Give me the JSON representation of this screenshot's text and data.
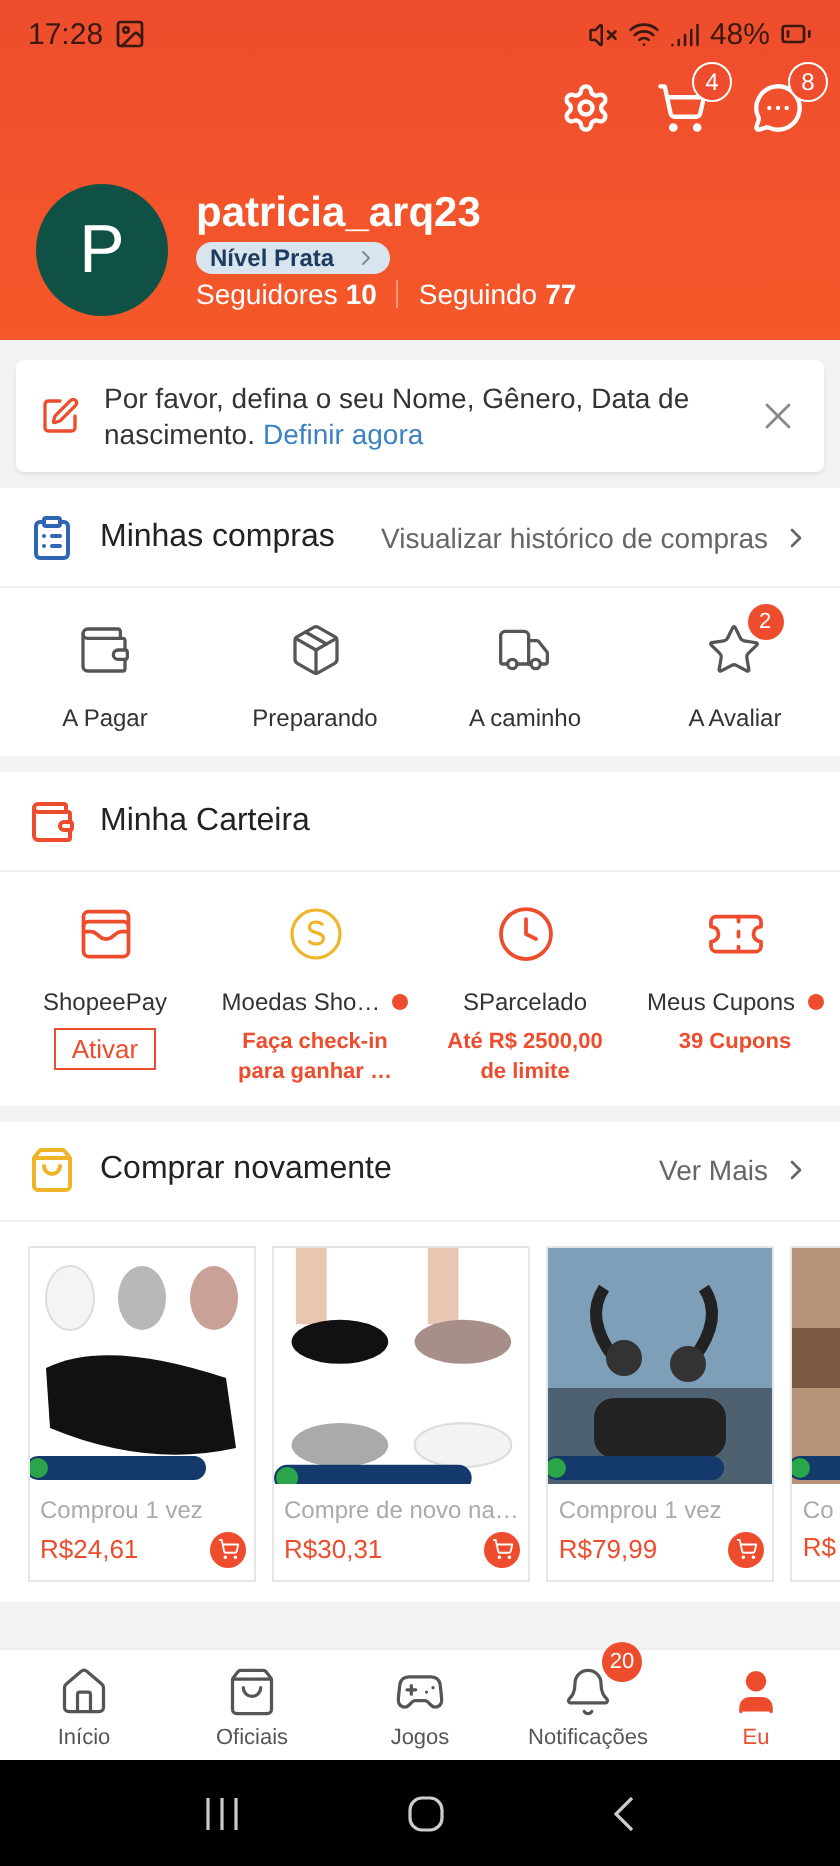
{
  "status_bar": {
    "time": "17:28",
    "battery": "48%"
  },
  "header_actions": [
    {
      "kind": "settings"
    },
    {
      "kind": "cart",
      "badge": "4"
    },
    {
      "kind": "chat",
      "badge": "8"
    }
  ],
  "profile": {
    "avatar": "P",
    "username": "patricia_arq23",
    "level": "Nível Prata",
    "followers_label": "Seguidores",
    "followers": "10",
    "following_label": "Seguindo",
    "following": "77"
  },
  "notice": {
    "text": "Por favor, defina o seu Nome, Gênero, Data de nascimento.",
    "link": "Definir agora"
  },
  "purchases": {
    "title": "Minhas compras",
    "link": "Visualizar histórico de compras",
    "items": [
      {
        "kind": "pay",
        "label": "A Pagar"
      },
      {
        "kind": "box",
        "label": "Preparando"
      },
      {
        "kind": "truck",
        "label": "A caminho"
      },
      {
        "kind": "review",
        "label": "A Avaliar",
        "badge": "2"
      }
    ]
  },
  "wallet": {
    "title": "Minha Carteira",
    "items": [
      {
        "kind": "shopeepay",
        "label": "ShopeePay",
        "dot": false,
        "button": "Ativar"
      },
      {
        "kind": "coins",
        "label": "Moedas Sho…",
        "dot": true,
        "detail": "Faça check-in para ganhar …"
      },
      {
        "kind": "installments",
        "label": "SParcelado",
        "dot": false,
        "detail": "Até R$ 2500,00 de limite"
      },
      {
        "kind": "coupons",
        "label": "Meus Cupons",
        "dot": true,
        "detail": "39 Cupons"
      }
    ]
  },
  "rebuy": {
    "title": "Comprar novamente",
    "link": "Ver Mais",
    "products": [
      {
        "kind": "picture",
        "note": "Comprou 1 vez",
        "price": "R$24,61"
      },
      {
        "kind": "picture",
        "note": "Compre de novo na…",
        "price": "R$30,31"
      },
      {
        "kind": "picture",
        "note": "Comprou 1 vez",
        "price": "R$79,99"
      },
      {
        "kind": "picture",
        "note": "Co",
        "price": "R$"
      }
    ]
  },
  "bottom_nav": [
    {
      "kind": "home",
      "label": "Início",
      "selected": false
    },
    {
      "kind": "bag",
      "label": "Oficiais",
      "selected": false
    },
    {
      "kind": "game",
      "label": "Jogos",
      "selected": false
    },
    {
      "kind": "bell",
      "label": "Notificações",
      "selected": false,
      "badge": "20"
    },
    {
      "kind": "person",
      "label": "Eu",
      "selected": true
    }
  ]
}
